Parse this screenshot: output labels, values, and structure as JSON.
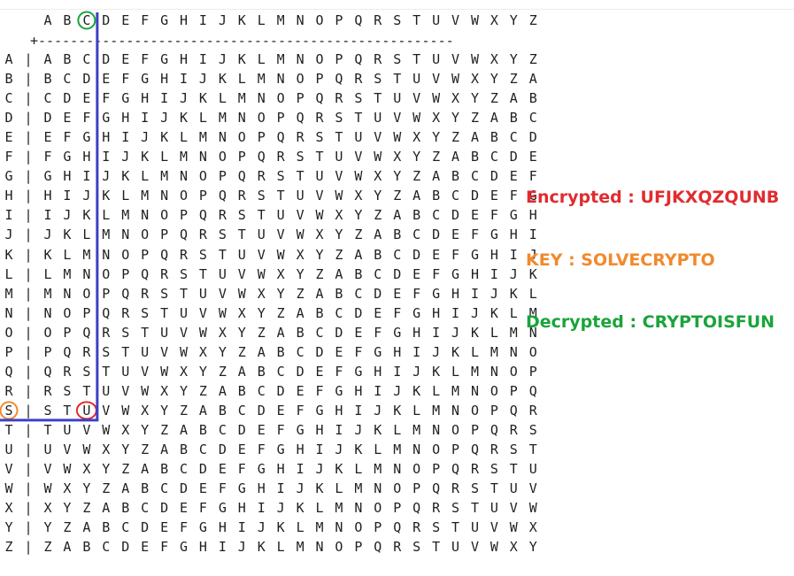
{
  "header_letters": [
    "A",
    "B",
    "C",
    "D",
    "E",
    "F",
    "G",
    "H",
    "I",
    "J",
    "K",
    "L",
    "M",
    "N",
    "O",
    "P",
    "Q",
    "R",
    "S",
    "T",
    "U",
    "V",
    "W",
    "X",
    "Y",
    "Z"
  ],
  "header_rule": "+----------------------------------------------------",
  "row_separator": "|",
  "rows": [
    {
      "label": "A",
      "letters": [
        "A",
        "B",
        "C",
        "D",
        "E",
        "F",
        "G",
        "H",
        "I",
        "J",
        "K",
        "L",
        "M",
        "N",
        "O",
        "P",
        "Q",
        "R",
        "S",
        "T",
        "U",
        "V",
        "W",
        "X",
        "Y",
        "Z"
      ]
    },
    {
      "label": "B",
      "letters": [
        "B",
        "C",
        "D",
        "E",
        "F",
        "G",
        "H",
        "I",
        "J",
        "K",
        "L",
        "M",
        "N",
        "O",
        "P",
        "Q",
        "R",
        "S",
        "T",
        "U",
        "V",
        "W",
        "X",
        "Y",
        "Z",
        "A"
      ]
    },
    {
      "label": "C",
      "letters": [
        "C",
        "D",
        "E",
        "F",
        "G",
        "H",
        "I",
        "J",
        "K",
        "L",
        "M",
        "N",
        "O",
        "P",
        "Q",
        "R",
        "S",
        "T",
        "U",
        "V",
        "W",
        "X",
        "Y",
        "Z",
        "A",
        "B"
      ]
    },
    {
      "label": "D",
      "letters": [
        "D",
        "E",
        "F",
        "G",
        "H",
        "I",
        "J",
        "K",
        "L",
        "M",
        "N",
        "O",
        "P",
        "Q",
        "R",
        "S",
        "T",
        "U",
        "V",
        "W",
        "X",
        "Y",
        "Z",
        "A",
        "B",
        "C"
      ]
    },
    {
      "label": "E",
      "letters": [
        "E",
        "F",
        "G",
        "H",
        "I",
        "J",
        "K",
        "L",
        "M",
        "N",
        "O",
        "P",
        "Q",
        "R",
        "S",
        "T",
        "U",
        "V",
        "W",
        "X",
        "Y",
        "Z",
        "A",
        "B",
        "C",
        "D"
      ]
    },
    {
      "label": "F",
      "letters": [
        "F",
        "G",
        "H",
        "I",
        "J",
        "K",
        "L",
        "M",
        "N",
        "O",
        "P",
        "Q",
        "R",
        "S",
        "T",
        "U",
        "V",
        "W",
        "X",
        "Y",
        "Z",
        "A",
        "B",
        "C",
        "D",
        "E"
      ]
    },
    {
      "label": "G",
      "letters": [
        "G",
        "H",
        "I",
        "J",
        "K",
        "L",
        "M",
        "N",
        "O",
        "P",
        "Q",
        "R",
        "S",
        "T",
        "U",
        "V",
        "W",
        "X",
        "Y",
        "Z",
        "A",
        "B",
        "C",
        "D",
        "E",
        "F"
      ]
    },
    {
      "label": "H",
      "letters": [
        "H",
        "I",
        "J",
        "K",
        "L",
        "M",
        "N",
        "O",
        "P",
        "Q",
        "R",
        "S",
        "T",
        "U",
        "V",
        "W",
        "X",
        "Y",
        "Z",
        "A",
        "B",
        "C",
        "D",
        "E",
        "F",
        "G"
      ]
    },
    {
      "label": "I",
      "letters": [
        "I",
        "J",
        "K",
        "L",
        "M",
        "N",
        "O",
        "P",
        "Q",
        "R",
        "S",
        "T",
        "U",
        "V",
        "W",
        "X",
        "Y",
        "Z",
        "A",
        "B",
        "C",
        "D",
        "E",
        "F",
        "G",
        "H"
      ]
    },
    {
      "label": "J",
      "letters": [
        "J",
        "K",
        "L",
        "M",
        "N",
        "O",
        "P",
        "Q",
        "R",
        "S",
        "T",
        "U",
        "V",
        "W",
        "X",
        "Y",
        "Z",
        "A",
        "B",
        "C",
        "D",
        "E",
        "F",
        "G",
        "H",
        "I"
      ]
    },
    {
      "label": "K",
      "letters": [
        "K",
        "L",
        "M",
        "N",
        "O",
        "P",
        "Q",
        "R",
        "S",
        "T",
        "U",
        "V",
        "W",
        "X",
        "Y",
        "Z",
        "A",
        "B",
        "C",
        "D",
        "E",
        "F",
        "G",
        "H",
        "I",
        "J"
      ]
    },
    {
      "label": "L",
      "letters": [
        "L",
        "M",
        "N",
        "O",
        "P",
        "Q",
        "R",
        "S",
        "T",
        "U",
        "V",
        "W",
        "X",
        "Y",
        "Z",
        "A",
        "B",
        "C",
        "D",
        "E",
        "F",
        "G",
        "H",
        "I",
        "J",
        "K"
      ]
    },
    {
      "label": "M",
      "letters": [
        "M",
        "N",
        "O",
        "P",
        "Q",
        "R",
        "S",
        "T",
        "U",
        "V",
        "W",
        "X",
        "Y",
        "Z",
        "A",
        "B",
        "C",
        "D",
        "E",
        "F",
        "G",
        "H",
        "I",
        "J",
        "K",
        "L"
      ]
    },
    {
      "label": "N",
      "letters": [
        "N",
        "O",
        "P",
        "Q",
        "R",
        "S",
        "T",
        "U",
        "V",
        "W",
        "X",
        "Y",
        "Z",
        "A",
        "B",
        "C",
        "D",
        "E",
        "F",
        "G",
        "H",
        "I",
        "J",
        "K",
        "L",
        "M"
      ]
    },
    {
      "label": "O",
      "letters": [
        "O",
        "P",
        "Q",
        "R",
        "S",
        "T",
        "U",
        "V",
        "W",
        "X",
        "Y",
        "Z",
        "A",
        "B",
        "C",
        "D",
        "E",
        "F",
        "G",
        "H",
        "I",
        "J",
        "K",
        "L",
        "M",
        "N"
      ]
    },
    {
      "label": "P",
      "letters": [
        "P",
        "Q",
        "R",
        "S",
        "T",
        "U",
        "V",
        "W",
        "X",
        "Y",
        "Z",
        "A",
        "B",
        "C",
        "D",
        "E",
        "F",
        "G",
        "H",
        "I",
        "J",
        "K",
        "L",
        "M",
        "N",
        "O"
      ]
    },
    {
      "label": "Q",
      "letters": [
        "Q",
        "R",
        "S",
        "T",
        "U",
        "V",
        "W",
        "X",
        "Y",
        "Z",
        "A",
        "B",
        "C",
        "D",
        "E",
        "F",
        "G",
        "H",
        "I",
        "J",
        "K",
        "L",
        "M",
        "N",
        "O",
        "P"
      ]
    },
    {
      "label": "R",
      "letters": [
        "R",
        "S",
        "T",
        "U",
        "V",
        "W",
        "X",
        "Y",
        "Z",
        "A",
        "B",
        "C",
        "D",
        "E",
        "F",
        "G",
        "H",
        "I",
        "J",
        "K",
        "L",
        "M",
        "N",
        "O",
        "P",
        "Q"
      ]
    },
    {
      "label": "S",
      "letters": [
        "S",
        "T",
        "U",
        "V",
        "W",
        "X",
        "Y",
        "Z",
        "A",
        "B",
        "C",
        "D",
        "E",
        "F",
        "G",
        "H",
        "I",
        "J",
        "K",
        "L",
        "M",
        "N",
        "O",
        "P",
        "Q",
        "R"
      ]
    },
    {
      "label": "T",
      "letters": [
        "T",
        "U",
        "V",
        "W",
        "X",
        "Y",
        "Z",
        "A",
        "B",
        "C",
        "D",
        "E",
        "F",
        "G",
        "H",
        "I",
        "J",
        "K",
        "L",
        "M",
        "N",
        "O",
        "P",
        "Q",
        "R",
        "S"
      ]
    },
    {
      "label": "U",
      "letters": [
        "U",
        "V",
        "W",
        "X",
        "Y",
        "Z",
        "A",
        "B",
        "C",
        "D",
        "E",
        "F",
        "G",
        "H",
        "I",
        "J",
        "K",
        "L",
        "M",
        "N",
        "O",
        "P",
        "Q",
        "R",
        "S",
        "T"
      ]
    },
    {
      "label": "V",
      "letters": [
        "V",
        "W",
        "X",
        "Y",
        "Z",
        "A",
        "B",
        "C",
        "D",
        "E",
        "F",
        "G",
        "H",
        "I",
        "J",
        "K",
        "L",
        "M",
        "N",
        "O",
        "P",
        "Q",
        "R",
        "S",
        "T",
        "U"
      ]
    },
    {
      "label": "W",
      "letters": [
        "W",
        "X",
        "Y",
        "Z",
        "A",
        "B",
        "C",
        "D",
        "E",
        "F",
        "G",
        "H",
        "I",
        "J",
        "K",
        "L",
        "M",
        "N",
        "O",
        "P",
        "Q",
        "R",
        "S",
        "T",
        "U",
        "V"
      ]
    },
    {
      "label": "X",
      "letters": [
        "X",
        "Y",
        "Z",
        "A",
        "B",
        "C",
        "D",
        "E",
        "F",
        "G",
        "H",
        "I",
        "J",
        "K",
        "L",
        "M",
        "N",
        "O",
        "P",
        "Q",
        "R",
        "S",
        "T",
        "U",
        "V",
        "W"
      ]
    },
    {
      "label": "Y",
      "letters": [
        "Y",
        "Z",
        "A",
        "B",
        "C",
        "D",
        "E",
        "F",
        "G",
        "H",
        "I",
        "J",
        "K",
        "L",
        "M",
        "N",
        "O",
        "P",
        "Q",
        "R",
        "S",
        "T",
        "U",
        "V",
        "W",
        "X"
      ]
    },
    {
      "label": "Z",
      "letters": [
        "Z",
        "A",
        "B",
        "C",
        "D",
        "E",
        "F",
        "G",
        "H",
        "I",
        "J",
        "K",
        "L",
        "M",
        "N",
        "O",
        "P",
        "Q",
        "R",
        "S",
        "T",
        "U",
        "V",
        "W",
        "X",
        "Y"
      ]
    }
  ],
  "highlights": {
    "header_column": {
      "letter": "C",
      "color": "#1aa43b"
    },
    "row_label": {
      "letter": "S",
      "color": "#f2892c"
    },
    "intersection_cell": {
      "row": "S",
      "column": "C",
      "letter": "U",
      "color": "#e02c2f"
    },
    "path_color": "#3c40c6"
  },
  "legend": {
    "encrypted": "Encrypted : UFJKXQZQUNB",
    "key": "KEY : SOLVECRYPTO",
    "decrypted": "Decrypted : CRYPTOISFUN"
  },
  "colors": {
    "encrypted": "#e02c2f",
    "key": "#f2892c",
    "decrypted": "#1aa43b",
    "text": "#1f1f1f"
  }
}
